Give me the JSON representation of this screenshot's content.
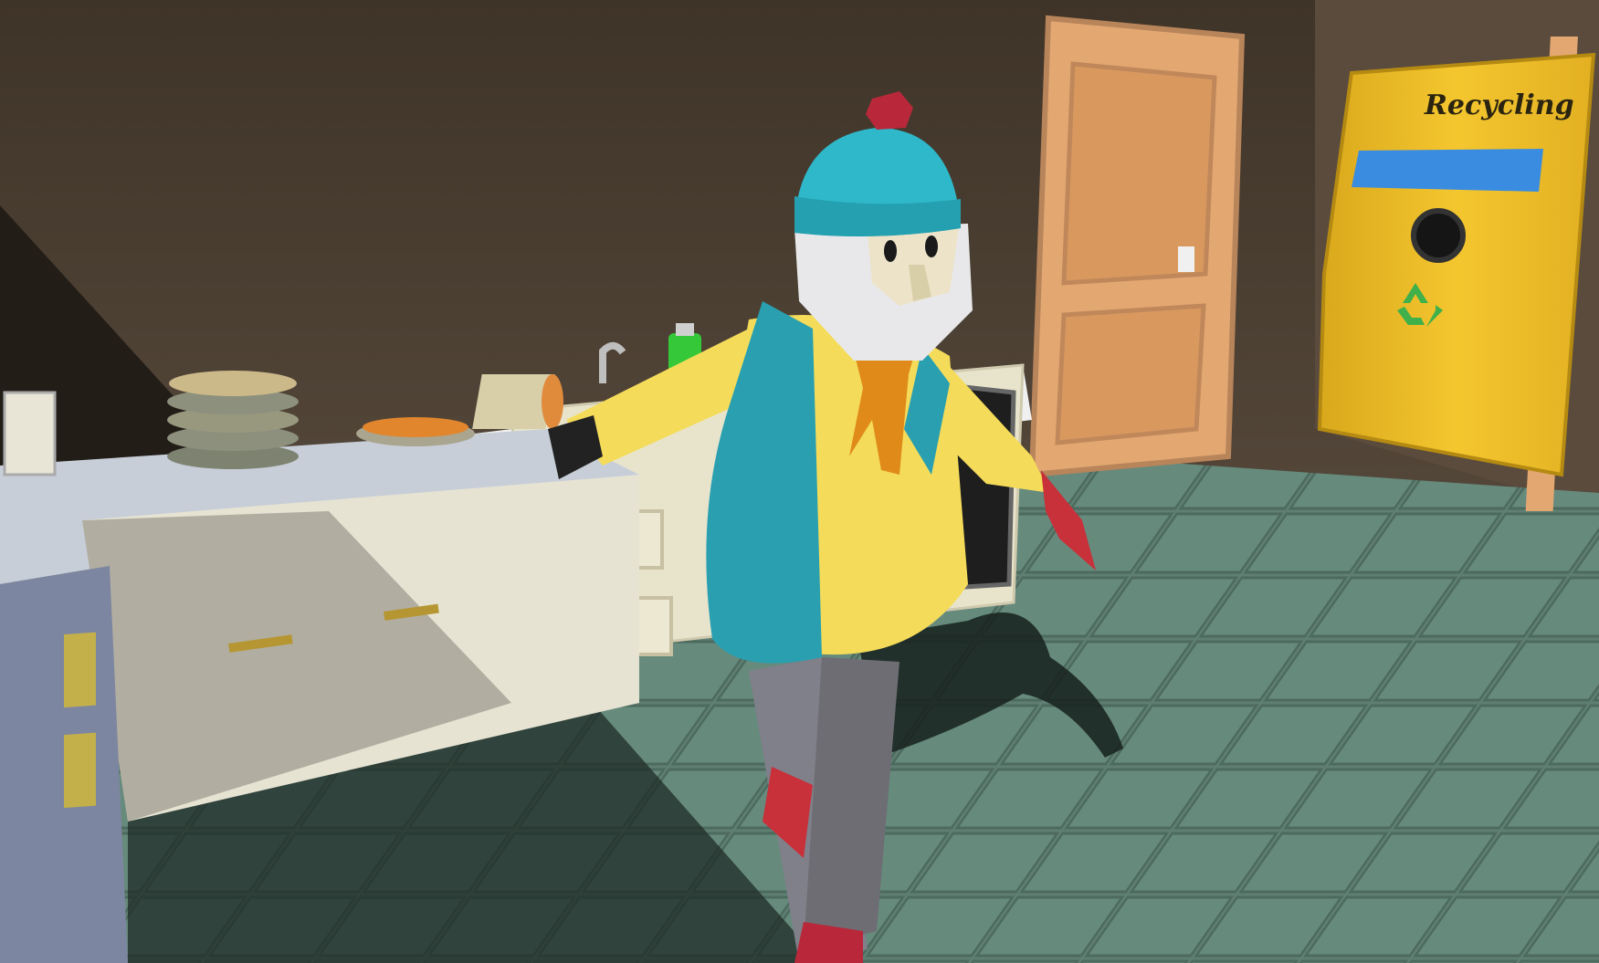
{
  "scene": {
    "location": "kitchen",
    "recycling_bin": {
      "label": "Recycling",
      "icon": "recycle-icon",
      "color": "#f0c12a",
      "slot_color": "#3a8ce0"
    },
    "character": {
      "hat_color": "#2fb8c9",
      "pompom_color": "#b8283a",
      "jacket_color": "#f4dc5a",
      "vest_color": "#2a9fb0",
      "scarf_color": "#e08a1a",
      "glove_color": "#c8303a",
      "pants_color": "#7f7f86"
    },
    "colors": {
      "wall": "#4a3d31",
      "floor": "#5f7f72",
      "door": "#e3a872",
      "counter": "#eeeeee",
      "cabinet": "#e8e4cc"
    }
  }
}
